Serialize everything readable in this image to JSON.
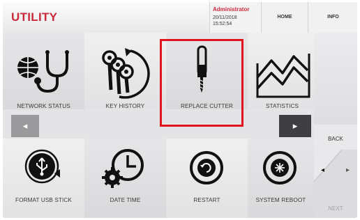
{
  "header": {
    "title": "UTILITY",
    "user": "Administrator",
    "date": "20/11/2018",
    "time": "15:52:54",
    "home_label": "HOME",
    "info_label": "INFO"
  },
  "tiles": [
    {
      "label": "NETWORK STATUS",
      "icon": "network-stethoscope-icon"
    },
    {
      "label": "KEY HISTORY",
      "icon": "keys-history-icon"
    },
    {
      "label": "REPLACE CUTTER",
      "icon": "cutter-icon"
    },
    {
      "label": "STATISTICS",
      "icon": "line-chart-icon"
    },
    {
      "label": "FORMAT USB STICK",
      "icon": "usb-format-icon"
    },
    {
      "label": "DATE TIME",
      "icon": "clock-gear-icon"
    },
    {
      "label": "RESTART",
      "icon": "restart-icon"
    },
    {
      "label": "SYSTEM REBOOT",
      "icon": "system-reboot-icon"
    }
  ],
  "nav": {
    "prev_arrow": "◂",
    "next_arrow": "▸",
    "back_label": "BACK",
    "next_label": "NEXT",
    "left_glyph": "◂",
    "right_glyph": "▸"
  },
  "colors": {
    "accent": "#c8293b",
    "selection": "#e0141c"
  }
}
